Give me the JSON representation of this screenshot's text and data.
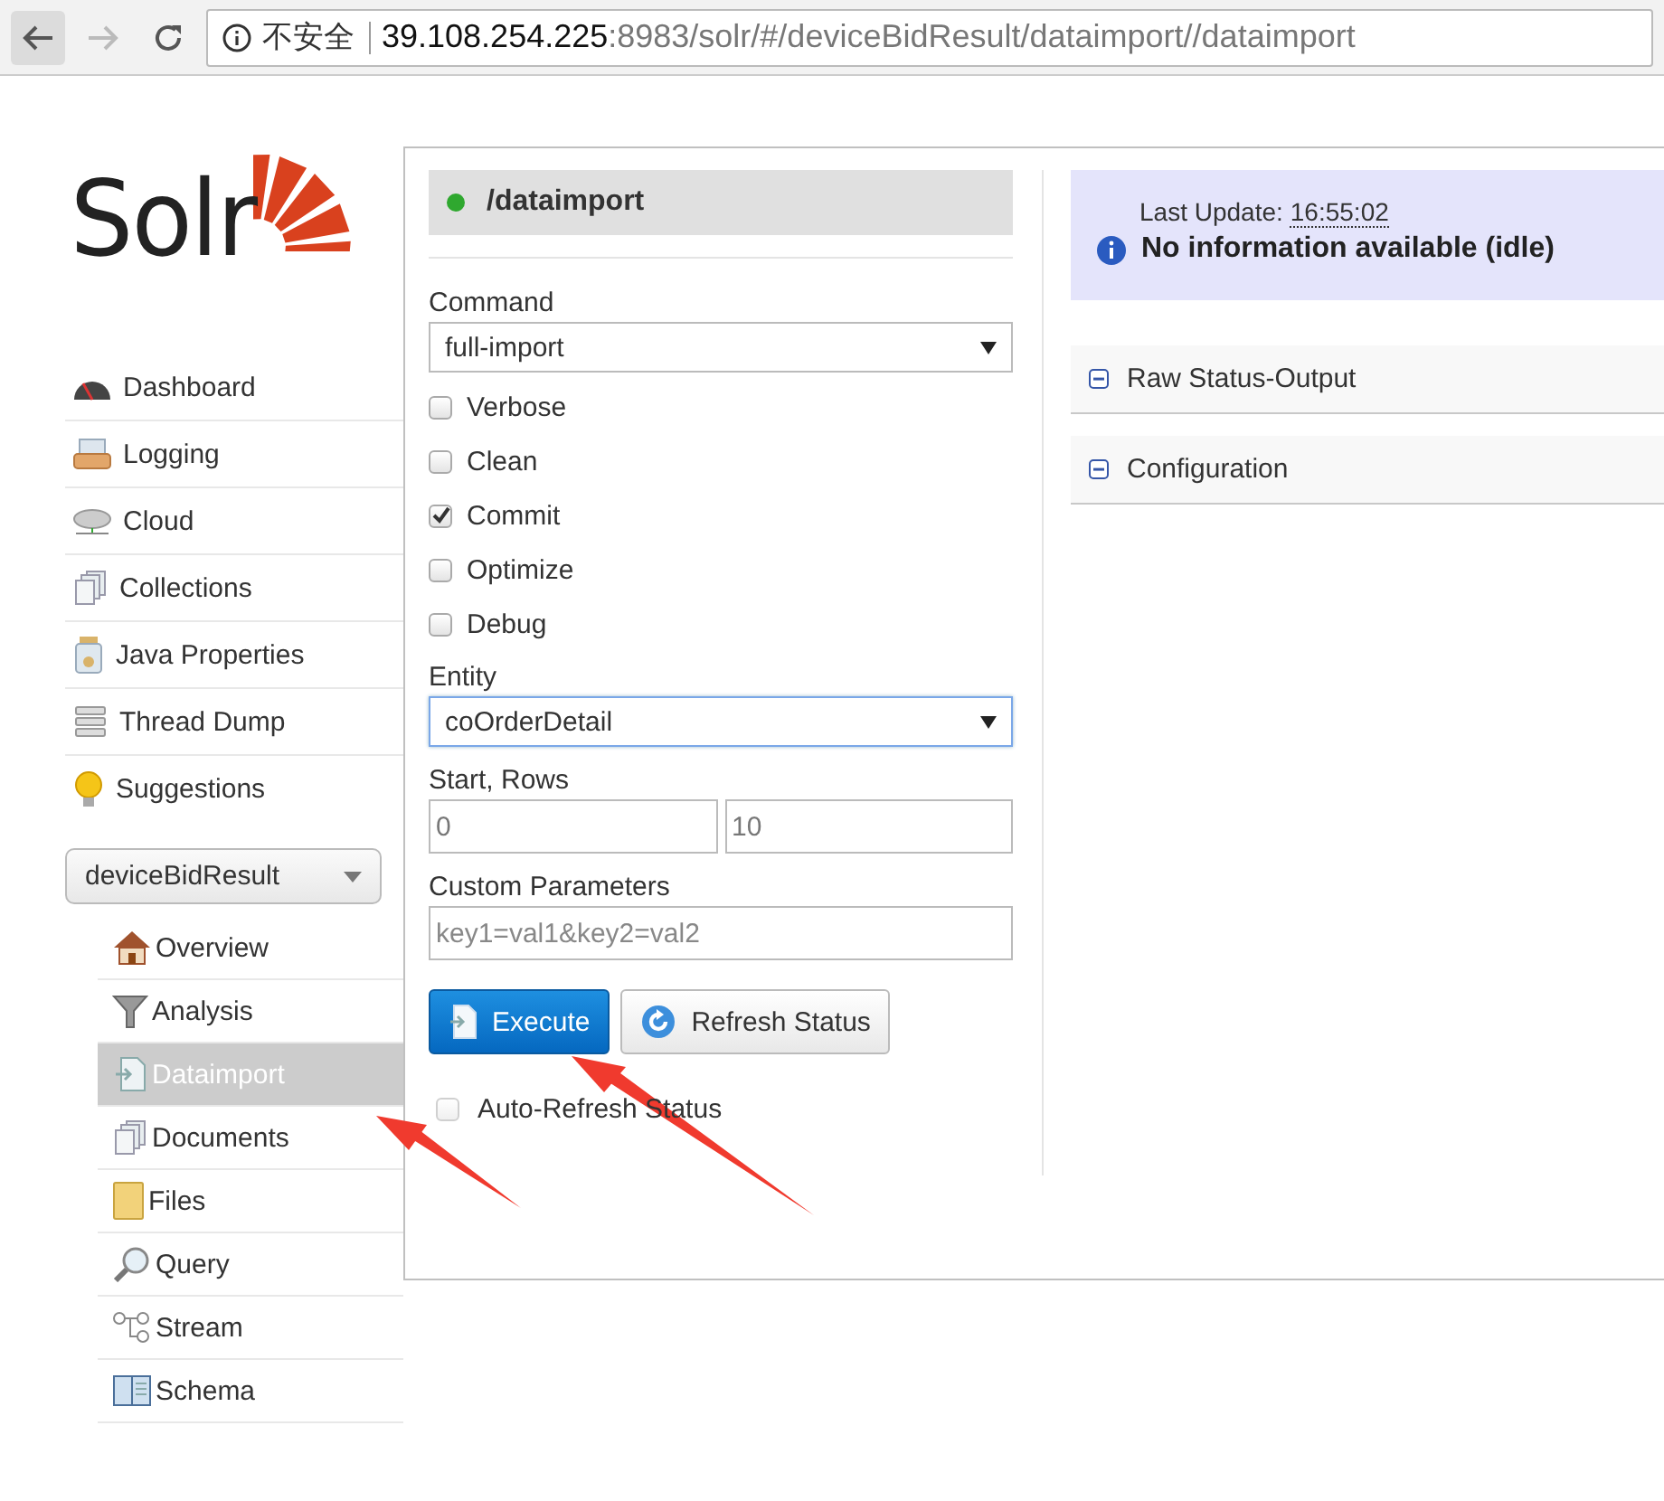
{
  "browser": {
    "security": "不安全",
    "url_host": "39.108.254.225",
    "url_rest": ":8983/solr/#/deviceBidResult/dataimport//dataimport"
  },
  "logo": {
    "text": "Solr"
  },
  "sidebar": {
    "items": [
      {
        "label": "Dashboard"
      },
      {
        "label": "Logging"
      },
      {
        "label": "Cloud"
      },
      {
        "label": "Collections"
      },
      {
        "label": "Java Properties"
      },
      {
        "label": "Thread Dump"
      },
      {
        "label": "Suggestions"
      }
    ],
    "core_selector": {
      "value": "deviceBidResult"
    },
    "core_items": [
      {
        "label": "Overview",
        "selected": false
      },
      {
        "label": "Analysis",
        "selected": false
      },
      {
        "label": "Dataimport",
        "selected": true
      },
      {
        "label": "Documents",
        "selected": false
      },
      {
        "label": "Files",
        "selected": false
      },
      {
        "label": "Query",
        "selected": false
      },
      {
        "label": "Stream",
        "selected": false
      },
      {
        "label": "Schema",
        "selected": false
      }
    ]
  },
  "handler": {
    "title": "/dataimport",
    "active": true
  },
  "form": {
    "command": {
      "label": "Command",
      "value": "full-import",
      "focused": false
    },
    "options": [
      {
        "label": "Verbose",
        "checked": false
      },
      {
        "label": "Clean",
        "checked": false
      },
      {
        "label": "Commit",
        "checked": true
      },
      {
        "label": "Optimize",
        "checked": false
      },
      {
        "label": "Debug",
        "checked": false
      }
    ],
    "entity": {
      "label": "Entity",
      "value": "coOrderDetail",
      "focused": true
    },
    "start_rows": {
      "label": "Start, Rows",
      "start": "0",
      "rows": "10"
    },
    "custom_parameters": {
      "label": "Custom Parameters",
      "placeholder": "key1=val1&key2=val2"
    },
    "buttons": [
      {
        "label": "Execute",
        "kind": "primary"
      },
      {
        "label": "Refresh Status",
        "kind": "secondary"
      }
    ],
    "auto_refresh": {
      "label": "Auto-Refresh Status",
      "checked": false
    }
  },
  "status": {
    "last_update_label": "Last Update:",
    "last_update_time": "16:55:02",
    "message": "No information available (idle)"
  },
  "sections": [
    {
      "title": "Raw Status-Output"
    },
    {
      "title": "Configuration"
    }
  ]
}
